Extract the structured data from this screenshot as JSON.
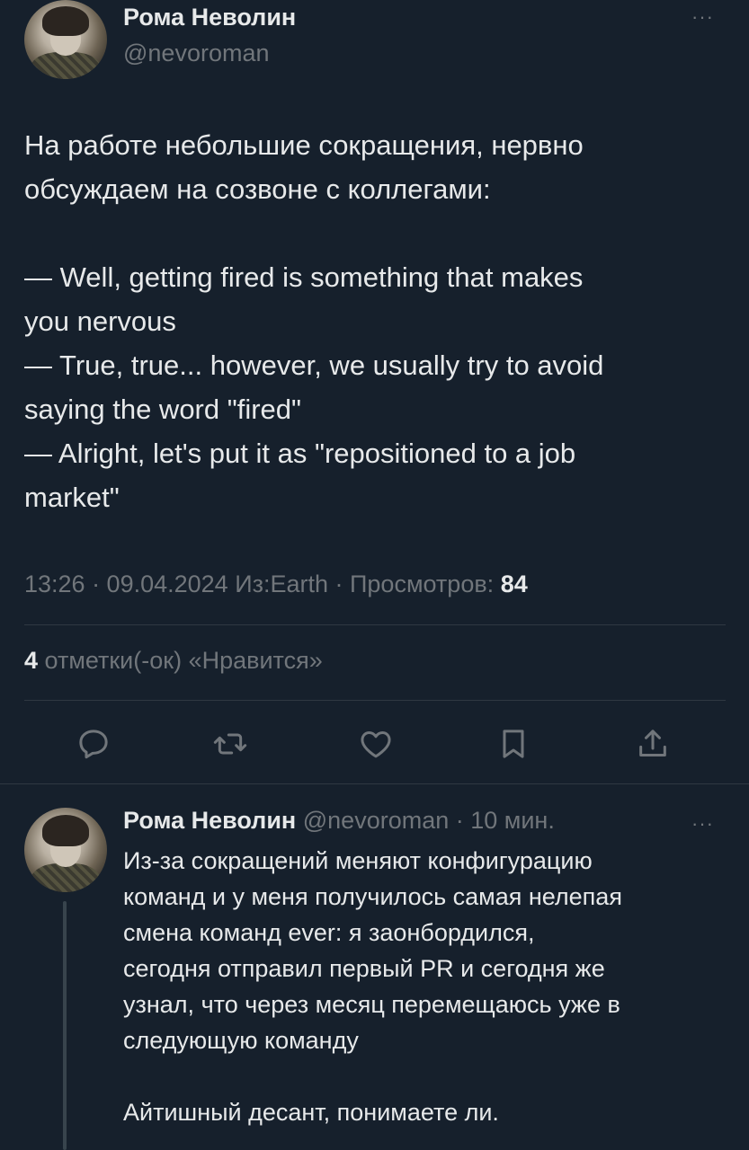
{
  "tweet": {
    "author_name": "Рома Неволин",
    "author_handle": "@nevoroman",
    "more_label": "···",
    "text": "На работе небольшие сокращения, нервно\nобсуждаем на созвоне с коллегами:\n\n— Well, getting fired is something that makes\nyou nervous\n— True, true... however, we usually try to avoid\nsaying the word \"fired\"\n— Alright, let's put it as \"repositioned to a job\nmarket\"",
    "meta_prefix": "13:26 · 09.04.2024 Из:Earth · Просмотров: ",
    "views": "84",
    "likes_count": "4",
    "likes_label": " отметки(-ок) «Нравится»"
  },
  "actions": [
    {
      "name": "reply",
      "icon": "reply-icon"
    },
    {
      "name": "retweet",
      "icon": "retweet-icon"
    },
    {
      "name": "like",
      "icon": "heart-icon"
    },
    {
      "name": "bookmark",
      "icon": "bookmark-icon"
    },
    {
      "name": "share",
      "icon": "share-icon"
    }
  ],
  "reply": {
    "author_name": "Рома Неволин",
    "handle_time": " @nevoroman · 10 мин.",
    "more_label": "···",
    "text": "Из-за сокращений меняют конфигурацию\nкоманд и у меня получилось самая нелепая\nсмена команд ever: я заонбордился,\nсегодня отправил первый PR и сегодня же\nузнал, что через месяц перемещаюсь уже в\nследующую команду\n\nАйтишный десант, понимаете ли."
  },
  "colors": {
    "background": "#16202c",
    "text": "#e7e9ea",
    "secondary": "#71767b",
    "divider": "#2f3842"
  }
}
